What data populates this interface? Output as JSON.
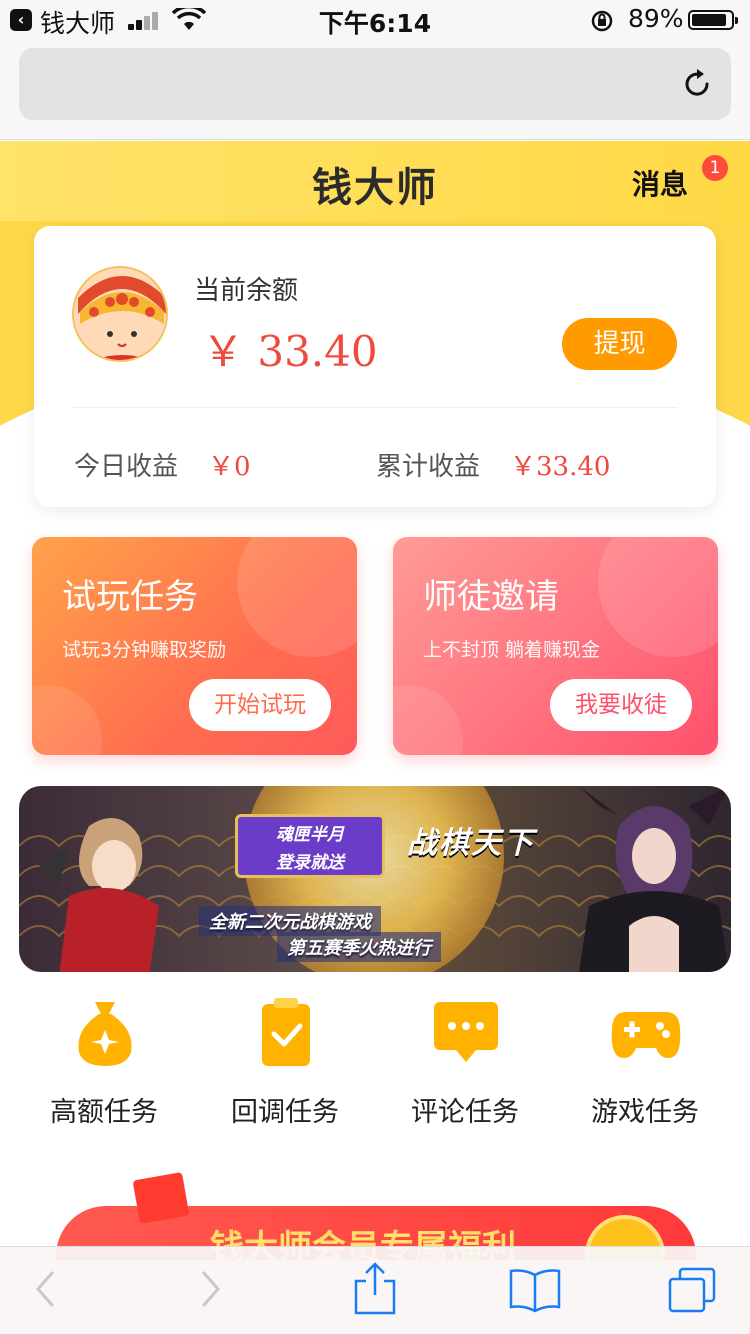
{
  "status_bar": {
    "back_app": "钱大师",
    "time": "下午6:14",
    "battery": "89%",
    "battery_level": 0.89
  },
  "header": {
    "logo": "钱大师",
    "messages_label": "消息",
    "messages_badge": "1"
  },
  "balance_card": {
    "label": "当前余额",
    "value": "￥ 33.40",
    "withdraw_label": "提现",
    "today_label": "今日收益",
    "today_value": "￥0",
    "total_label": "累计收益",
    "total_value": "￥33.40"
  },
  "tasks": [
    {
      "title": "试玩任务",
      "subtitle": "试玩3分钟赚取奖励",
      "button": "开始试玩"
    },
    {
      "title": "师徒邀请",
      "subtitle": "上不封顶 躺着赚现金",
      "button": "我要收徒"
    }
  ],
  "banner": {
    "box_line1": "魂匣半月",
    "box_line2": "登录就送",
    "logo": "战棋天下",
    "tag1": "全新二次元战棋游戏",
    "tag2": "第五赛季火热进行"
  },
  "categories": [
    {
      "label": "高额任务",
      "icon": "money-bag-icon"
    },
    {
      "label": "回调任务",
      "icon": "clipboard-check-icon"
    },
    {
      "label": "评论任务",
      "icon": "comment-icon"
    },
    {
      "label": "游戏任务",
      "icon": "gamepad-icon"
    }
  ],
  "promo": {
    "text": "钱大师会员专属福利"
  },
  "colors": {
    "brand_yellow": "#ffd84a",
    "accent_orange": "#ff9a00",
    "money_red": "#f04a3e",
    "icon_yellow": "#ffb300"
  }
}
